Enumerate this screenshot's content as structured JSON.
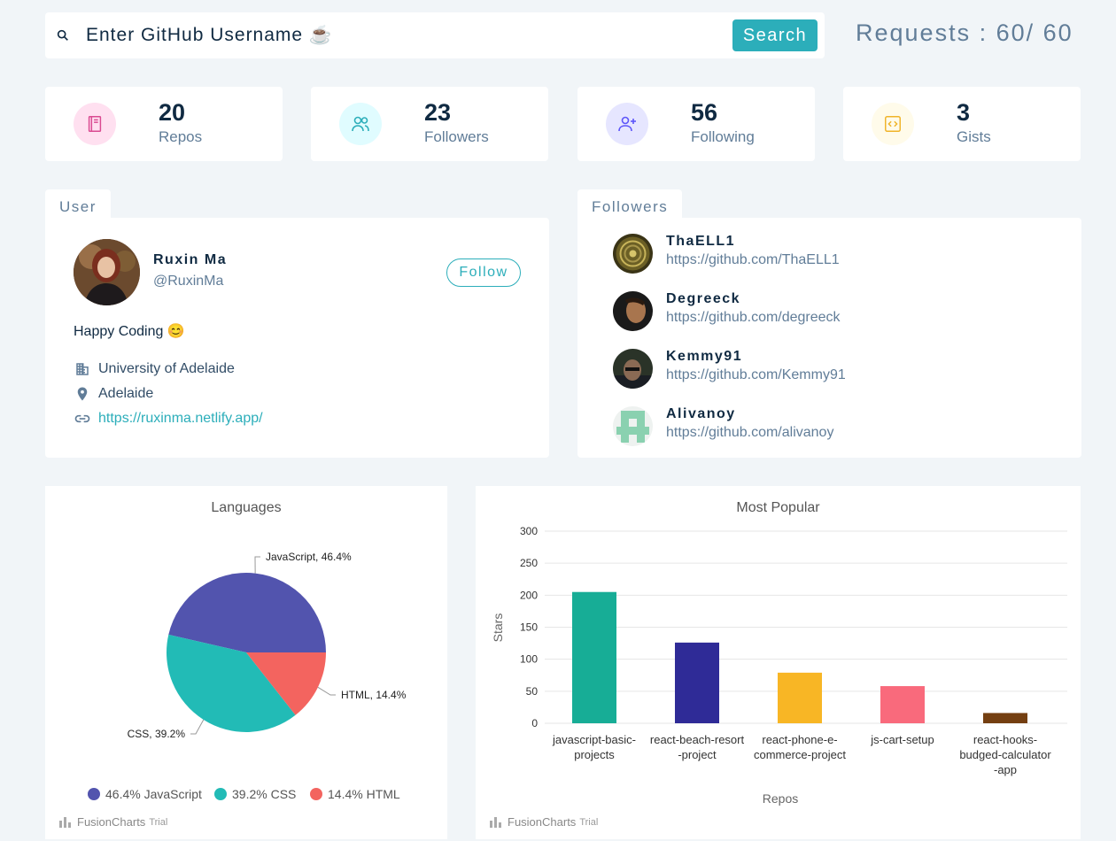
{
  "search": {
    "placeholder": "Enter GitHub Username ☕",
    "button_label": "Search"
  },
  "requests": {
    "text": "Requests : 60/ 60"
  },
  "stats": [
    {
      "value": "20",
      "label": "Repos",
      "icon": "book-icon",
      "color": "#da4a91",
      "bg": "#ffe0f0"
    },
    {
      "value": "23",
      "label": "Followers",
      "icon": "users-icon",
      "color": "#2caeba",
      "bg": "#e0fcff"
    },
    {
      "value": "56",
      "label": "Following",
      "icon": "user-plus-icon",
      "color": "#5d55fa",
      "bg": "#e6e6ff"
    },
    {
      "value": "3",
      "label": "Gists",
      "icon": "code-icon",
      "color": "#f0b429",
      "bg": "#fffbea"
    }
  ],
  "user": {
    "tab_label": "User",
    "name": "Ruxin Ma",
    "handle": "@RuxinMa",
    "follow_label": "Follow",
    "bio": "Happy Coding 😊",
    "company": "University of Adelaide",
    "location": "Adelaide",
    "blog": "https://ruxinma.netlify.app/"
  },
  "followers": {
    "tab_label": "Followers",
    "items": [
      {
        "login": "ThaELL1",
        "url": "https://github.com/ThaELL1"
      },
      {
        "login": "Degreeck",
        "url": "https://github.com/degreeck"
      },
      {
        "login": "Kemmy91",
        "url": "https://github.com/Kemmy91"
      },
      {
        "login": "Alivanoy",
        "url": "https://github.com/alivanoy"
      }
    ]
  },
  "branding": {
    "name": "FusionCharts",
    "trial": "Trial"
  },
  "chart_data": [
    {
      "type": "pie",
      "title": "Languages",
      "slices": [
        {
          "label": "JavaScript",
          "value": 46.4,
          "color": "#5254ae",
          "callout": "JavaScript, 46.4%",
          "legend": "46.4% JavaScript"
        },
        {
          "label": "CSS",
          "value": 39.2,
          "color": "#22bbb6",
          "callout": "CSS, 39.2%",
          "legend": "39.2% CSS"
        },
        {
          "label": "HTML",
          "value": 14.4,
          "color": "#f3645f",
          "callout": "HTML, 14.4%",
          "legend": "14.4% HTML"
        }
      ]
    },
    {
      "type": "bar",
      "title": "Most Popular",
      "xlabel": "Repos",
      "ylabel": "Stars",
      "ylim": [
        0,
        300
      ],
      "yticks": [
        "0",
        "50",
        "100",
        "150",
        "200",
        "250",
        "300"
      ],
      "categories": [
        [
          "javascript-basic-",
          "projects"
        ],
        [
          "react-beach-resort",
          "-project"
        ],
        [
          "react-phone-e-",
          "commerce-project"
        ],
        [
          "js-cart-setup"
        ],
        [
          "react-hooks-",
          "budged-calculator",
          "-app"
        ]
      ],
      "values": [
        205,
        126,
        79,
        58,
        16
      ],
      "colors": [
        "#17ad96",
        "#2f2b97",
        "#f8b625",
        "#f96a7c",
        "#743f11"
      ]
    }
  ]
}
